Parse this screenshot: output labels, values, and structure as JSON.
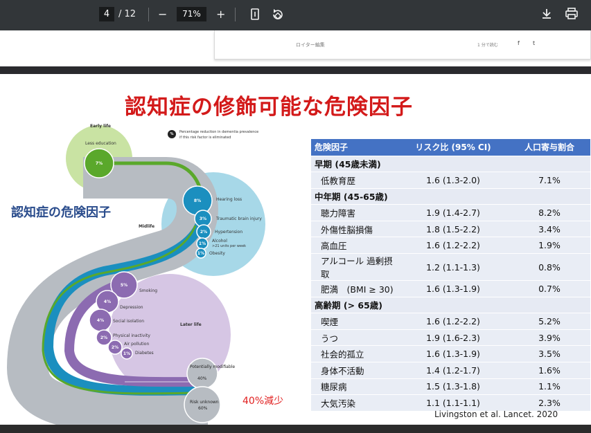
{
  "toolbar": {
    "page_current": "4",
    "page_total": "/ 12",
    "zoom": "71%",
    "zoom_out": "−",
    "zoom_in": "+"
  },
  "article_card": {
    "author": "ロイター編集",
    "read_time": "1 分で読む",
    "share_facebook": "f",
    "share_twitter": "t"
  },
  "slide": {
    "title": "認知症の修飾可能な危険因子",
    "subtitle": "認知症の危険因子",
    "reduction": "40%減少",
    "citation": "Livingston et al. Lancet. 2020"
  },
  "infographic": {
    "legend_pct": "%",
    "legend_text": [
      "Percentage reduction in dementia prevalence",
      "if this risk factor is eliminated"
    ],
    "early_life": "Early life",
    "midlife": "Midlife",
    "later_life": "Later life",
    "factors": [
      {
        "label": "Less education",
        "pct": "7%"
      },
      {
        "label": "Hearing loss",
        "pct": "8%"
      },
      {
        "label": "Traumatic brain injury",
        "pct": "3%"
      },
      {
        "label": "Hypertension",
        "pct": "2%"
      },
      {
        "label": "Alcohol",
        "sub": ">21 units per week",
        "pct": "1%"
      },
      {
        "label": "Obesity",
        "pct": "1%"
      },
      {
        "label": "Smoking",
        "pct": "5%"
      },
      {
        "label": "Depression",
        "pct": "4%"
      },
      {
        "label": "Social isolation",
        "pct": "4%"
      },
      {
        "label": "Physical inactivity",
        "pct": "2%"
      },
      {
        "label": "Air pollution",
        "pct": "2%"
      },
      {
        "label": "Diabetes",
        "pct": "1%"
      }
    ],
    "modifiable_label": "Potentially modifiable",
    "modifiable_pct": "40%",
    "unknown_label": "Risk unknown",
    "unknown_pct": "60%"
  },
  "table": {
    "headers": [
      "危険因子",
      "リスク比 (95% CI)",
      "人口寄与割合"
    ],
    "sections": [
      {
        "title": "早期 (45歳未満)",
        "rows": [
          {
            "name": "低教育歴",
            "risk": "1.6 (1.3-2.0)",
            "paf": "7.1%"
          }
        ]
      },
      {
        "title": "中年期 (45-65歳)",
        "rows": [
          {
            "name": "聴力障害",
            "risk": "1.9 (1.4-2.7)",
            "paf": "8.2%"
          },
          {
            "name": "外傷性脳損傷",
            "risk": "1.8 (1.5-2.2)",
            "paf": "3.4%"
          },
          {
            "name": "高血圧",
            "risk": "1.6 (1.2-2.2)",
            "paf": "1.9%"
          },
          {
            "name": "アルコール 過剰摂取",
            "risk": "1.2 (1.1-1.3)",
            "paf": "0.8%"
          },
          {
            "name": "肥満　(BMI ≥ 30)",
            "risk": "1.6 (1.3-1.9)",
            "paf": "0.7%"
          }
        ]
      },
      {
        "title": "高齢期 (> 65歳)",
        "rows": [
          {
            "name": "喫煙",
            "risk": "1.6 (1.2-2.2)",
            "paf": "5.2%"
          },
          {
            "name": "うつ",
            "risk": "1.9 (1.6-2.3)",
            "paf": "3.9%"
          },
          {
            "name": "社会的孤立",
            "risk": "1.6 (1.3-1.9)",
            "paf": "3.5%"
          },
          {
            "name": "身体不活動",
            "risk": "1.4 (1.2-1.7)",
            "paf": "1.6%"
          },
          {
            "name": "糖尿病",
            "risk": "1.5 (1.3-1.8)",
            "paf": "1.1%"
          },
          {
            "name": "大気汚染",
            "risk": "1.1 (1.1-1.1)",
            "paf": "2.3%"
          }
        ]
      }
    ]
  }
}
